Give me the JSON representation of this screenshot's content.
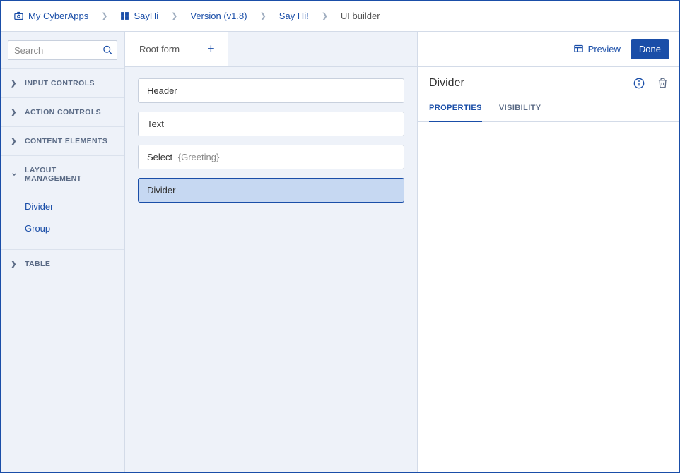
{
  "breadcrumb": {
    "items": [
      {
        "label": "My CyberApps",
        "icon": "camera"
      },
      {
        "label": "SayHi",
        "icon": "grid"
      },
      {
        "label": "Version (v1.8)"
      },
      {
        "label": "Say Hi!"
      },
      {
        "label": "UI builder",
        "current": true
      }
    ]
  },
  "search": {
    "placeholder": "Search"
  },
  "sidebar": {
    "categories": [
      {
        "label": "INPUT CONTROLS",
        "expanded": false
      },
      {
        "label": "ACTION CONTROLS",
        "expanded": false
      },
      {
        "label": "CONTENT ELEMENTS",
        "expanded": false
      },
      {
        "label": "LAYOUT MANAGEMENT",
        "expanded": true,
        "items": [
          "Divider",
          "Group"
        ]
      },
      {
        "label": "TABLE",
        "expanded": false
      }
    ]
  },
  "form": {
    "tab_label": "Root form",
    "controls": [
      {
        "label": "Header"
      },
      {
        "label": "Text"
      },
      {
        "label": "Select",
        "binding": "{Greeting}"
      },
      {
        "label": "Divider",
        "selected": true
      }
    ]
  },
  "toolbar": {
    "preview_label": "Preview",
    "done_label": "Done"
  },
  "properties": {
    "title": "Divider",
    "tabs": {
      "properties": "PROPERTIES",
      "visibility": "VISIBILITY"
    }
  }
}
